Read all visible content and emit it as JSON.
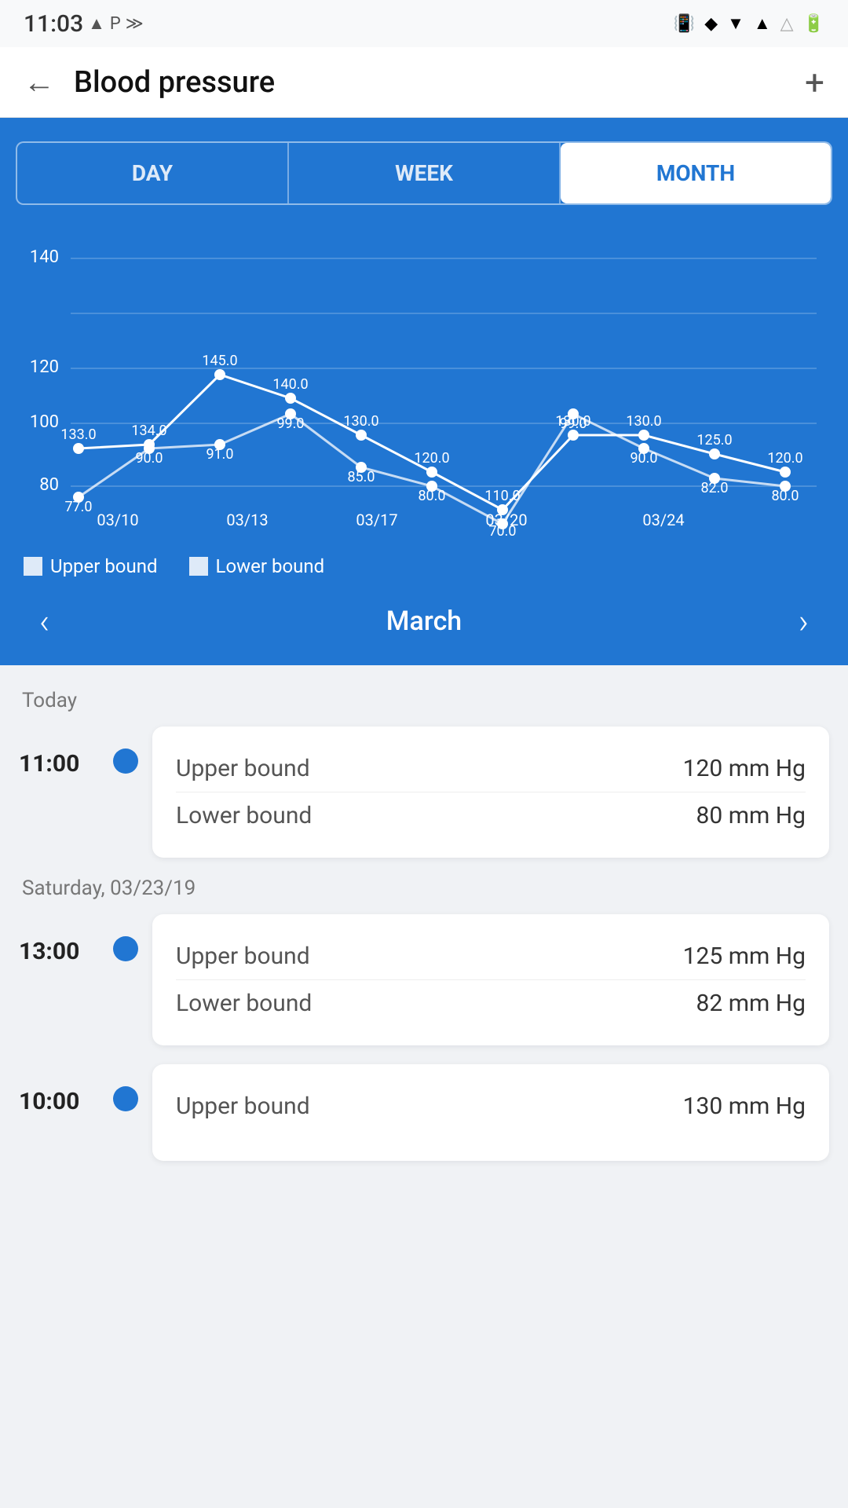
{
  "statusBar": {
    "time": "11:03",
    "leftIcons": [
      "▲",
      "P",
      "≫"
    ],
    "rightIcons": [
      "📳",
      "◆",
      "▼",
      "▲",
      "△",
      "🔋"
    ]
  },
  "header": {
    "backLabel": "←",
    "title": "Blood pressure",
    "addLabel": "+"
  },
  "tabs": [
    {
      "label": "DAY",
      "active": false
    },
    {
      "label": "WEEK",
      "active": false
    },
    {
      "label": "MONTH",
      "active": true
    }
  ],
  "chart": {
    "xLabels": [
      "03/10",
      "03/13",
      "03/17",
      "03/20",
      "03/24"
    ],
    "yLabels": [
      "80",
      "100",
      "120",
      "140"
    ],
    "upperPoints": [
      {
        "x": 0,
        "val": 133.0
      },
      {
        "x": 1,
        "val": 134.0
      },
      {
        "x": 2,
        "val": 145.0
      },
      {
        "x": 3,
        "val": 140.0
      },
      {
        "x": 4,
        "val": 130.0
      },
      {
        "x": 5,
        "val": 120.0
      },
      {
        "x": 6,
        "val": 110.0
      },
      {
        "x": 7,
        "val": 130.0
      },
      {
        "x": 8,
        "val": 130.0
      },
      {
        "x": 9,
        "val": 125.0
      },
      {
        "x": 10,
        "val": 120.0
      }
    ],
    "lowerPoints": [
      {
        "x": 0,
        "val": 77.0
      },
      {
        "x": 1,
        "val": 90.0
      },
      {
        "x": 2,
        "val": 91.0
      },
      {
        "x": 3,
        "val": 99.0
      },
      {
        "x": 4,
        "val": 85.0
      },
      {
        "x": 5,
        "val": 80.0
      },
      {
        "x": 6,
        "val": 70.0
      },
      {
        "x": 7,
        "val": 99.0
      },
      {
        "x": 8,
        "val": 90.0
      },
      {
        "x": 9,
        "val": 82.0
      },
      {
        "x": 10,
        "val": 80.0
      }
    ]
  },
  "legend": {
    "upperLabel": "Upper bound",
    "lowerLabel": "Lower bound"
  },
  "monthNav": {
    "prevArrow": "‹",
    "label": "March",
    "nextArrow": "›"
  },
  "listSections": [
    {
      "sectionLabel": "Today",
      "readings": [
        {
          "time": "11:00",
          "upperLabel": "Upper bound",
          "upperValue": "120 mm Hg",
          "lowerLabel": "Lower bound",
          "lowerValue": "80 mm Hg"
        }
      ]
    },
    {
      "sectionLabel": "Saturday, 03/23/19",
      "readings": [
        {
          "time": "13:00",
          "upperLabel": "Upper bound",
          "upperValue": "125 mm Hg",
          "lowerLabel": "Lower bound",
          "lowerValue": "82 mm Hg"
        }
      ]
    },
    {
      "sectionLabel": "",
      "readings": [
        {
          "time": "10:00",
          "upperLabel": "Upper bound",
          "upperValue": "130 mm Hg",
          "lowerLabel": "",
          "lowerValue": ""
        }
      ]
    }
  ]
}
